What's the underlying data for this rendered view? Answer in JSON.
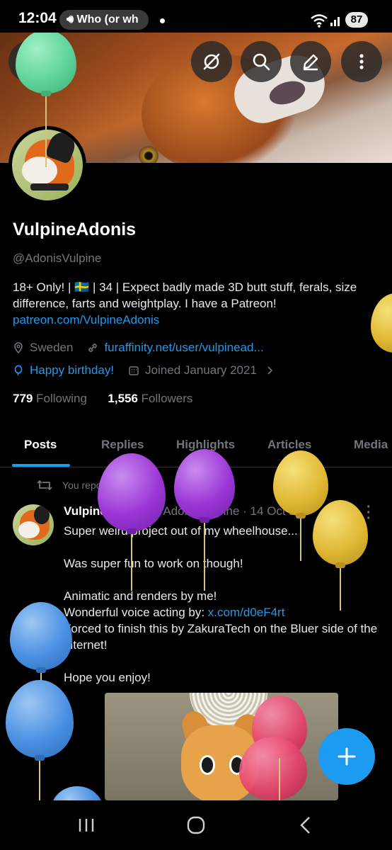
{
  "status_bar": {
    "time": "12:04",
    "media_label": "Who (or wh",
    "battery": "87"
  },
  "profile": {
    "display_name": "VulpineAdonis",
    "handle": "@AdonisVulpine",
    "bio_text": "18+ Only! | 🇸🇪 | 34 | Expect badly made 3D butt stuff, ferals, size difference, farts and weightplay. I have a Patreon! ",
    "bio_link": "patreon.com/VulpineAdonis",
    "location": "Sweden",
    "website": "furaffinity.net/user/vulpinead...",
    "birthday": "Happy birthday!",
    "joined": "Joined January 2021",
    "following_count": "779",
    "following_label": "Following",
    "followers_count": "1,556",
    "followers_label": "Followers"
  },
  "tabs": [
    {
      "label": "Posts"
    },
    {
      "label": "Replies"
    },
    {
      "label": "Highlights"
    },
    {
      "label": "Articles"
    },
    {
      "label": "Media"
    }
  ],
  "post": {
    "repost_label": "You reposted",
    "author_name": "VulpineAdonis",
    "author_handle": "@AdonisVulpine",
    "date": "· 14 Oct 24",
    "lines": [
      "Super weird project out of my wheelhouse...",
      "Was super fun to work on though!",
      "Animatic and renders by me!",
      "Wonderful voice acting by: ",
      "x.com/d0eF4rt",
      "Forced to finish this by ZakuraTech on the Bluer side of the internet!",
      "Hope you enjoy!"
    ]
  },
  "colors": {
    "accent": "#1d9bf0",
    "muted": "#71767b",
    "balloon_green": "#5fd39a",
    "balloon_purple": "#9b35d6",
    "balloon_yellow": "#e0b834",
    "balloon_blue": "#4a90e2",
    "balloon_pink": "#e8416b"
  },
  "icons": {
    "back": "back-arrow-icon",
    "grok": "grok-icon",
    "search": "search-icon",
    "edit": "edit-icon",
    "more": "more-vertical-icon",
    "compose": "plus-icon"
  }
}
